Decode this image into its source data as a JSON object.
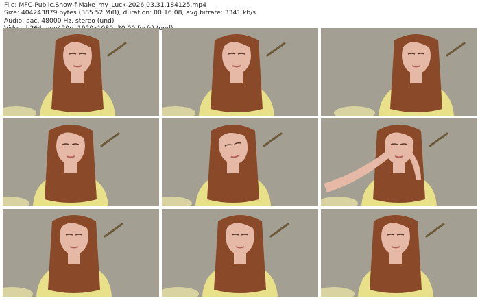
{
  "meta": {
    "line1": "File: MFC-Public.Show-f-Make_my_Luck-2026.03.31.184125.mp4",
    "line2": "Size: 404243879 bytes (385.52 MiB), duration: 00:16:08, avg.bitrate: 3341 kb/s",
    "line3": "Audio: aac, 48000 Hz, stereo (und)",
    "line4": "Video: h264, yuv420p, 1920x1080, 30.00 fps(r) (und)"
  },
  "thumbnails": [
    {
      "index": 1,
      "description": "woman in yellow shirt, looking down"
    },
    {
      "index": 2,
      "description": "woman in yellow shirt, smiling"
    },
    {
      "index": 3,
      "description": "woman in yellow shirt, looking at camera"
    },
    {
      "index": 4,
      "description": "woman in yellow shirt, eyes half closed"
    },
    {
      "index": 5,
      "description": "woman in yellow shirt, head tilted"
    },
    {
      "index": 6,
      "description": "woman in yellow shirt, hands near face"
    },
    {
      "index": 7,
      "description": "woman in yellow shirt, looking down"
    },
    {
      "index": 8,
      "description": "woman in yellow shirt, looking at camera"
    },
    {
      "index": 9,
      "description": "woman in yellow shirt, looking down"
    }
  ],
  "colors": {
    "wall": "#a39f92",
    "shirt": "#e9e08a",
    "hair": "#8a4a2a",
    "skin": "#e6b9a6"
  }
}
